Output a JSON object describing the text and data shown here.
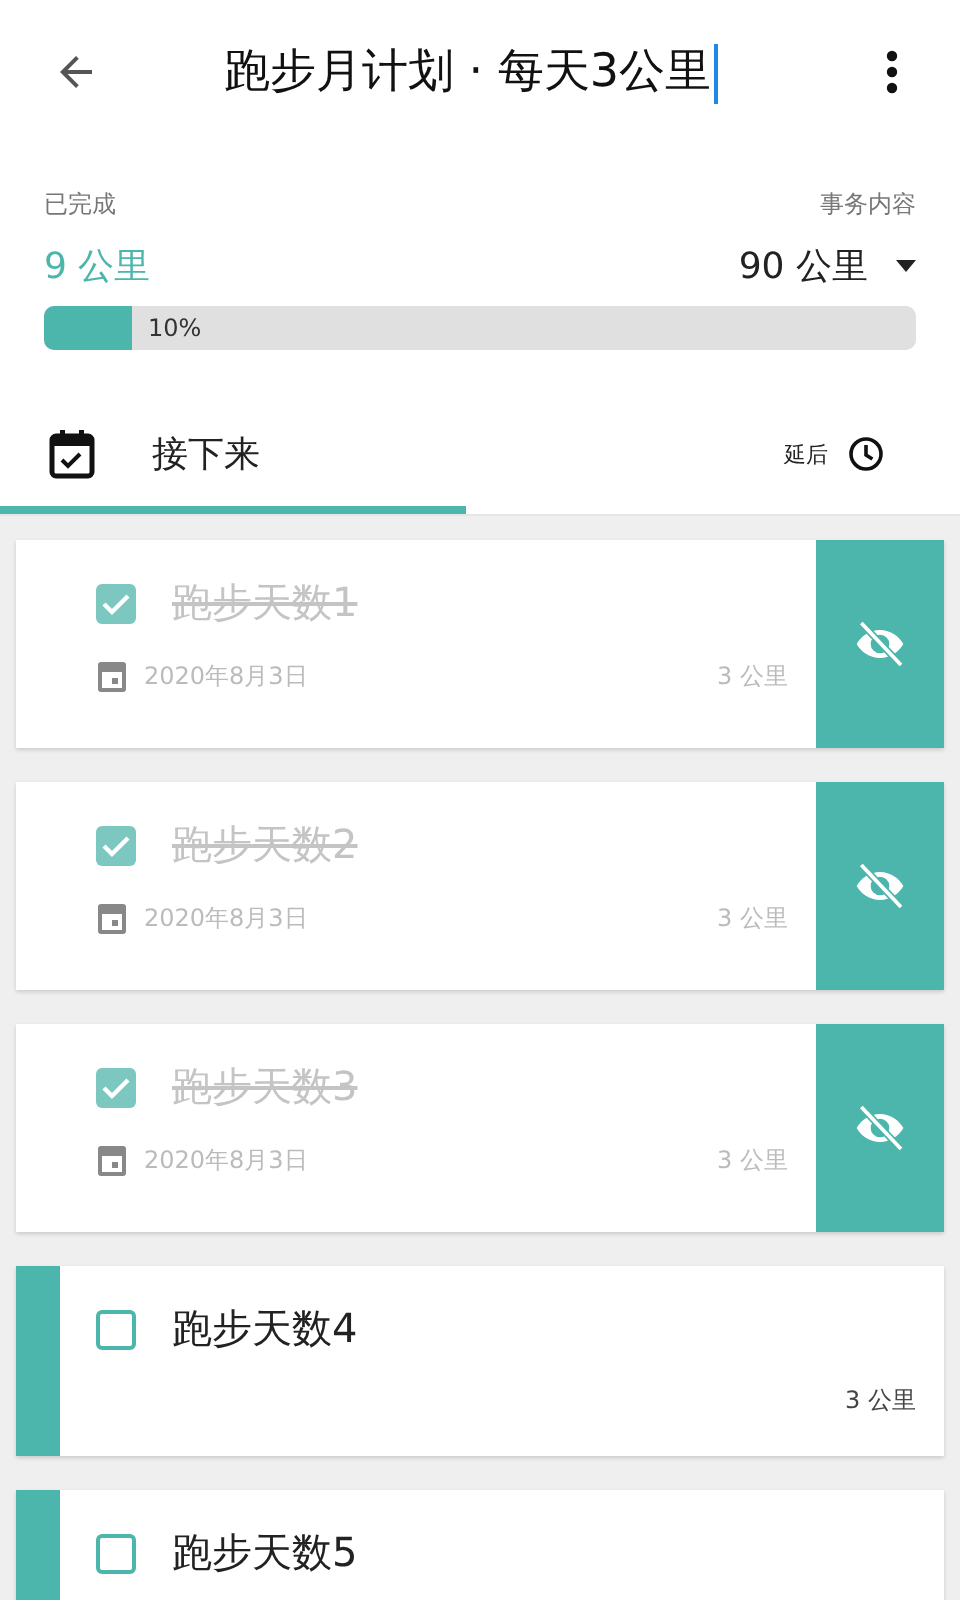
{
  "header": {
    "title": "跑步月计划 · 每天3公里"
  },
  "summary": {
    "done_label": "已完成",
    "done_value": "9 公里",
    "total_label": "事务内容",
    "total_value": "90 公里",
    "level": 0.1,
    "percent": "10%"
  },
  "tabs": [
    {
      "label": "接下来",
      "selected": true
    },
    {
      "label": "延后",
      "selected": false
    }
  ],
  "tasks": [
    {
      "title": "跑步天数1",
      "checked": true,
      "date": "2020年8月3日",
      "distance": "3 公里"
    },
    {
      "title": "跑步天数2",
      "checked": true,
      "date": "2020年8月3日",
      "distance": "3 公里"
    },
    {
      "title": "跑步天数3",
      "checked": true,
      "date": "2020年8月3日",
      "distance": "3 公里"
    },
    {
      "title": "跑步天数4",
      "checked": false,
      "distance": "3 公里"
    },
    {
      "title": "跑步天数5",
      "checked": false
    }
  ]
}
